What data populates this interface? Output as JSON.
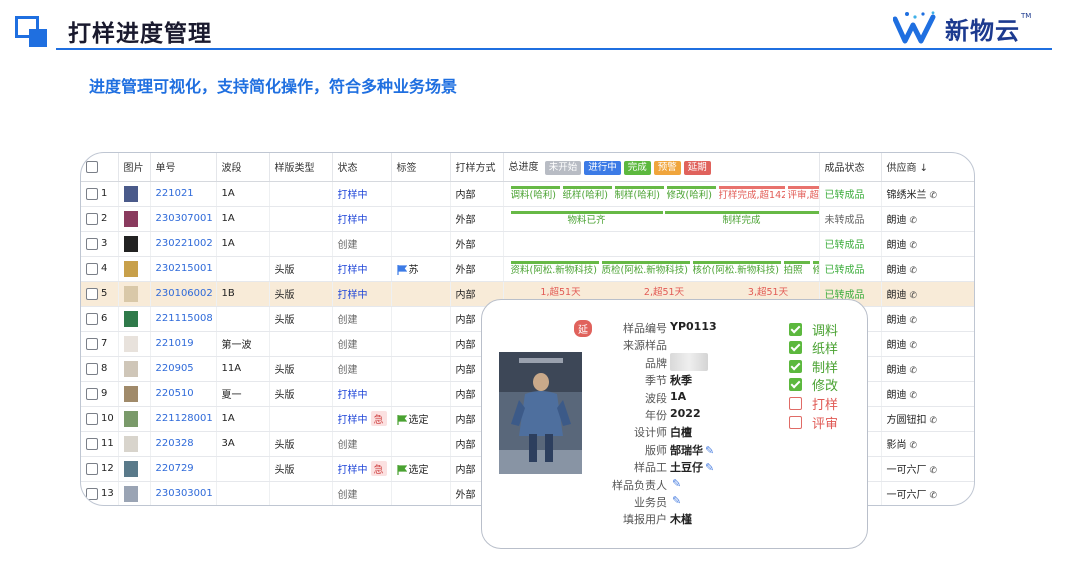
{
  "header": {
    "title": "打样进度管理",
    "subtitle": "进度管理可视化，支持简化操作，符合多种业务场景",
    "logo_text": "新物云",
    "logo_tm": "TM",
    "brand_color": "#1f6fe0"
  },
  "table": {
    "columns": {
      "image": "图片",
      "code": "单号",
      "wave": "波段",
      "pattern": "样版类型",
      "status": "状态",
      "tag": "标签",
      "method": "打样方式",
      "progress": "总进度",
      "product_status": "成品状态",
      "supplier": "供应商 ↓"
    },
    "progress_legend": [
      {
        "label": "未开始",
        "color": "#b8bcc4"
      },
      {
        "label": "进行中",
        "color": "#3c7be6"
      },
      {
        "label": "完成",
        "color": "#5cb83e"
      },
      {
        "label": "预警",
        "color": "#f0a53c"
      },
      {
        "label": "延期",
        "color": "#e0625c"
      }
    ],
    "rows": [
      {
        "n": "1",
        "code": "221021",
        "wave": "1A",
        "pattern": "",
        "status": "打样中",
        "tag": "",
        "method": "内部",
        "product": "已转成品",
        "supplier": "锦绣米兰",
        "segs": [
          "调料(哈利)",
          "纸样(哈利)",
          "制样(哈利)",
          "修改(哈利)",
          "打样完成,超142天",
          "评审,超"
        ]
      },
      {
        "n": "2",
        "code": "230307001",
        "wave": "1A",
        "pattern": "",
        "status": "打样中",
        "tag": "",
        "method": "外部",
        "product": "未转成品",
        "supplier": "朗迪",
        "segs": [
          "物料已齐",
          "制样完成"
        ]
      },
      {
        "n": "3",
        "code": "230221002",
        "wave": "1A",
        "pattern": "",
        "status": "创建",
        "tag": "",
        "method": "外部",
        "product": "已转成品",
        "supplier": "朗迪",
        "segs": []
      },
      {
        "n": "4",
        "code": "230215001",
        "wave": "",
        "pattern": "头版",
        "status": "打样中",
        "tag": "苏",
        "method": "外部",
        "product": "已转成品",
        "supplier": "朗迪",
        "segs": [
          "资料(阿松.新物科技)",
          "质检(阿松.新物科技)",
          "核价(阿松.新物科技)",
          "拍照",
          "修"
        ]
      },
      {
        "n": "5",
        "code": "230106002",
        "wave": "1B",
        "pattern": "头版",
        "status": "打样中",
        "tag": "",
        "method": "内部",
        "product": "已转成品",
        "supplier": "朗迪",
        "segs": [
          "1,超51天",
          "2,超51天",
          "3,超51天"
        ]
      },
      {
        "n": "6",
        "code": "221115008",
        "wave": "",
        "pattern": "头版",
        "status": "创建",
        "tag": "",
        "method": "内部",
        "product": "",
        "supplier": "朗迪",
        "segs": []
      },
      {
        "n": "7",
        "code": "221019",
        "wave": "第一波",
        "pattern": "",
        "status": "创建",
        "tag": "",
        "method": "内部",
        "product": "",
        "supplier": "朗迪",
        "segs": []
      },
      {
        "n": "8",
        "code": "220905",
        "wave": "11A",
        "pattern": "头版",
        "status": "创建",
        "tag": "",
        "method": "内部",
        "product": "",
        "supplier": "朗迪",
        "segs": []
      },
      {
        "n": "9",
        "code": "220510",
        "wave": "夏一",
        "pattern": "头版",
        "status": "打样中",
        "tag": "",
        "method": "内部",
        "product": "",
        "supplier": "朗迪",
        "segs": []
      },
      {
        "n": "10",
        "code": "221128001",
        "wave": "1A",
        "pattern": "",
        "status": "打样中",
        "urgent": "急",
        "tag": "选定",
        "method": "内部",
        "product": "",
        "supplier": "方圆钮扣",
        "segs": []
      },
      {
        "n": "11",
        "code": "220328",
        "wave": "3A",
        "pattern": "头版",
        "status": "创建",
        "tag": "",
        "method": "内部",
        "product": "",
        "supplier": "影尚",
        "segs": []
      },
      {
        "n": "12",
        "code": "220729",
        "wave": "",
        "pattern": "头版",
        "status": "打样中",
        "urgent": "急",
        "tag": "选定",
        "method": "内部",
        "product": "",
        "supplier": "一可六厂",
        "segs": []
      },
      {
        "n": "13",
        "code": "230303001",
        "wave": "",
        "pattern": "",
        "status": "创建",
        "tag": "",
        "method": "外部",
        "product": "",
        "supplier": "一可六厂",
        "segs": []
      }
    ]
  },
  "popup": {
    "badge": "延",
    "fields": [
      {
        "label": "样品编号",
        "value": "YP0113"
      },
      {
        "label": "来源样品",
        "value": ""
      },
      {
        "label": "品牌",
        "value": ""
      },
      {
        "label": "季节",
        "value": "秋季"
      },
      {
        "label": "波段",
        "value": "1A"
      },
      {
        "label": "年份",
        "value": "2022"
      },
      {
        "label": "设计师",
        "value": "白檀"
      },
      {
        "label": "版师",
        "value": "郜瑞华"
      },
      {
        "label": "样品工",
        "value": "土豆仔"
      },
      {
        "label": "样品负责人",
        "value": ""
      },
      {
        "label": "业务员",
        "value": ""
      },
      {
        "label": "填报用户",
        "value": "木槿"
      }
    ],
    "steps": [
      {
        "label": "调料",
        "done": true
      },
      {
        "label": "纸样",
        "done": true
      },
      {
        "label": "制样",
        "done": true
      },
      {
        "label": "修改",
        "done": true
      },
      {
        "label": "打样",
        "done": false
      },
      {
        "label": "评审",
        "done": false
      }
    ]
  }
}
